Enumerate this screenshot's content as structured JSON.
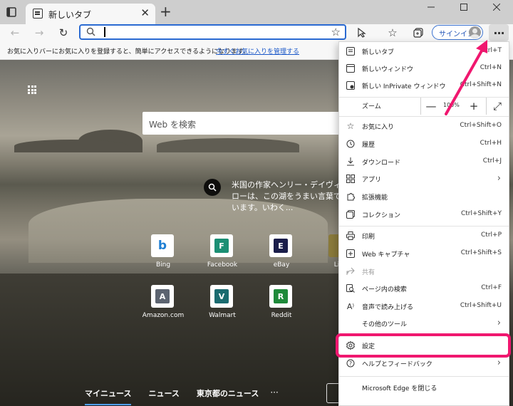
{
  "tab": {
    "title": "新しいタブ",
    "close": "✕"
  },
  "window": {
    "minimize": "—",
    "maximize": "☐",
    "close": "✕"
  },
  "toolbar": {
    "new_tab": "+",
    "back": "←",
    "forward": "→",
    "refresh": "↻",
    "signin_label": "サインイン",
    "more": "···"
  },
  "favbar": {
    "message": "お気に入りバーにお気に入りを登録すると、簡単にアクセスできるようになります。",
    "link": "今すぐお気に入りを管理する"
  },
  "ntp": {
    "search_placeholder": "Web を検索",
    "info_text": "米国の作家ヘンリー・デイヴィ ローは、この湖をうまい言葉で います。いわく...",
    "quicklinks": [
      {
        "label": "Bing",
        "letter": "b",
        "color": "#1f7fd4"
      },
      {
        "label": "Facebook",
        "letter": "F",
        "color": "#1b8f74"
      },
      {
        "label": "eBay",
        "letter": "E",
        "color": "#1a1d4a"
      },
      {
        "label": "Link",
        "letter": "",
        "color": "#8a7a3b"
      },
      {
        "label": "Amazon.com",
        "letter": "A",
        "color": "#5c6470"
      },
      {
        "label": "Walmart",
        "letter": "V",
        "color": "#1a6b6f"
      },
      {
        "label": "Reddit",
        "letter": "R",
        "color": "#1f8a3a"
      }
    ],
    "news_tabs": [
      "マイニュース",
      "ニュース",
      "東京都のニュース"
    ],
    "news_more": "···"
  },
  "menu": {
    "items": [
      {
        "label": "新しいタブ",
        "shortcut": "Ctrl+T",
        "icon": "new-tab-icon"
      },
      {
        "label": "新しいウィンドウ",
        "shortcut": "Ctrl+N",
        "icon": "new-window-icon"
      },
      {
        "label": "新しい InPrivate ウィンドウ",
        "shortcut": "Ctrl+Shift+N",
        "icon": "inprivate-icon"
      },
      {
        "label": "ズーム",
        "value": "100%"
      },
      {
        "label": "お気に入り",
        "shortcut": "Ctrl+Shift+O",
        "icon": "favorites-icon"
      },
      {
        "label": "履歴",
        "shortcut": "Ctrl+H",
        "icon": "history-icon"
      },
      {
        "label": "ダウンロード",
        "shortcut": "Ctrl+J",
        "icon": "download-icon"
      },
      {
        "label": "アプリ",
        "icon": "apps-icon"
      },
      {
        "label": "拡張機能",
        "icon": "extensions-icon"
      },
      {
        "label": "コレクション",
        "shortcut": "Ctrl+Shift+Y",
        "icon": "collections-icon"
      },
      {
        "label": "印刷",
        "shortcut": "Ctrl+P",
        "icon": "print-icon"
      },
      {
        "label": "Web キャプチャ",
        "shortcut": "Ctrl+Shift+S",
        "icon": "web-capture-icon"
      },
      {
        "label": "共有",
        "icon": "share-icon"
      },
      {
        "label": "ページ内の検索",
        "shortcut": "Ctrl+F",
        "icon": "find-icon"
      },
      {
        "label": "音声で読み上げる",
        "shortcut": "Ctrl+Shift+U",
        "icon": "read-aloud-icon"
      },
      {
        "label": "その他のツール"
      },
      {
        "label": "設定",
        "icon": "settings-icon"
      },
      {
        "label": "ヘルプとフィードバック",
        "icon": "help-icon"
      },
      {
        "label": "Microsoft Edge を閉じる"
      }
    ],
    "zoom_minus": "—",
    "zoom_plus": "+",
    "zoom_full": "⤢",
    "arrow": "›"
  },
  "colors": {
    "accent": "#2a6ad2",
    "highlight": "#f0176f"
  }
}
